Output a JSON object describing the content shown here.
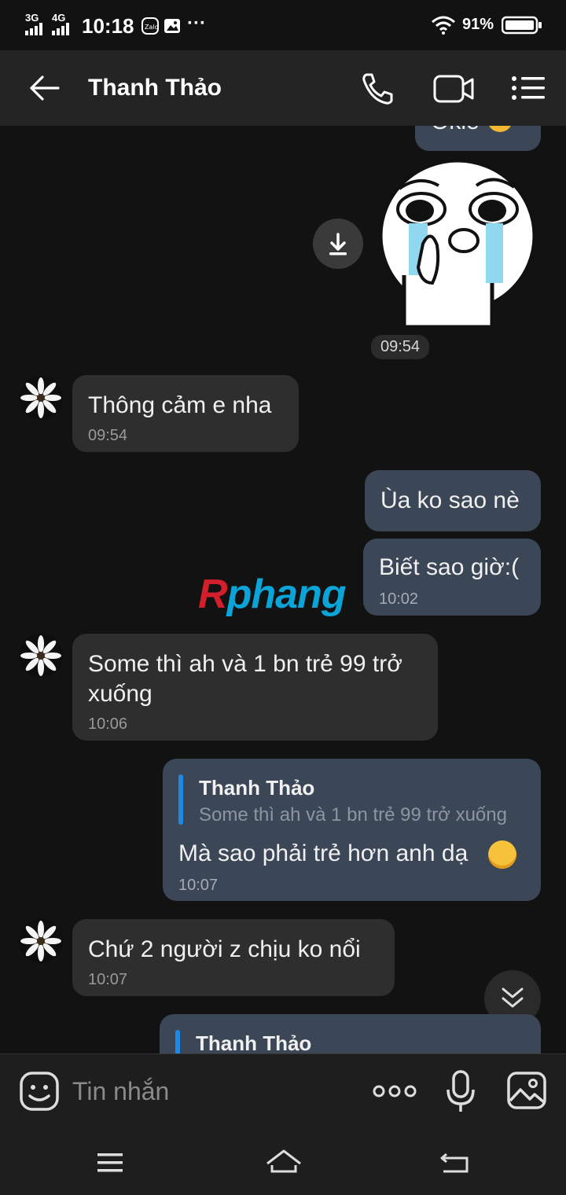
{
  "status_bar": {
    "net1": "3G",
    "net2": "4G",
    "time": "10:18",
    "battery": "91%"
  },
  "header": {
    "title": "Thanh Thảo"
  },
  "sticker_time": "09:54",
  "messages": [
    {
      "text": "Thông cảm e nha",
      "time": "09:54"
    },
    {
      "text": "Ùa ko sao nè"
    },
    {
      "text": "Biết sao giờ:(",
      "time": "10:02"
    },
    {
      "text": "Some thì ah và 1 bn trẻ 99 trở xuống",
      "time": "10:06"
    },
    {
      "quote_name": "Thanh Thảo",
      "quote_text": "Some thì ah và 1 bn trẻ 99 trở xuống",
      "text": "Mà sao phải trẻ hơn anh dạ",
      "time": "10:07"
    },
    {
      "text": "Chứ 2 người z chịu ko nổi",
      "time": "10:07"
    },
    {
      "quote_name": "Thanh Thảo"
    }
  ],
  "partial_top_text": "Okie",
  "watermark": {
    "r": "R",
    "rest": "phang"
  },
  "composer": {
    "placeholder": "Tin nhắn"
  },
  "colors": {
    "accent": "#1e88e5",
    "outgoing_bubble": "#3b4656",
    "incoming_bubble": "#2e2e2e"
  }
}
